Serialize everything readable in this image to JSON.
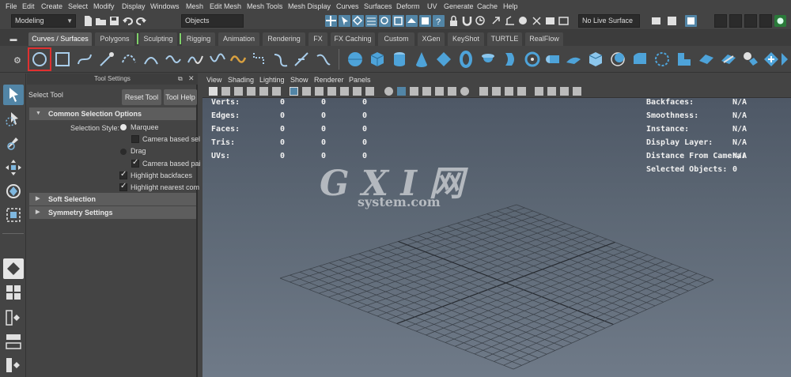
{
  "menubar": {
    "items": [
      "File",
      "Edit",
      "Create",
      "Select",
      "Modify",
      "Display",
      "Windows",
      "Mesh",
      "Edit Mesh",
      "Mesh Tools",
      "Mesh Display",
      "Curves",
      "Surfaces",
      "Deform",
      "UV",
      "Generate",
      "Cache",
      "Help"
    ]
  },
  "statusline": {
    "menuset": "Modeling",
    "selection_mode": "Objects",
    "live_surface": "No Live Surface"
  },
  "shelf": {
    "tabs": [
      "Curves / Surfaces",
      "Polygons",
      "Sculpting",
      "Rigging",
      "Animation",
      "Rendering",
      "FX",
      "FX Caching",
      "Custom",
      "XGen",
      "KeyShot",
      "TURTLE",
      "RealFlow"
    ],
    "active_tab": "Curves / Surfaces"
  },
  "tool_settings": {
    "panel_title": "Tool Settings",
    "tool_name": "Select Tool",
    "reset_button": "Reset Tool",
    "help_button": "Tool Help",
    "sections": {
      "common": "Common Selection Options",
      "soft": "Soft Selection",
      "symmetry": "Symmetry Settings"
    },
    "selection_style_label": "Selection Style:",
    "marquee": "Marquee",
    "camera_based_sel": "Camera based sel",
    "drag": "Drag",
    "camera_based_pai": "Camera based pai",
    "highlight_backfaces": "Highlight backfaces",
    "highlight_nearest": "Highlight nearest com"
  },
  "viewport": {
    "menu": [
      "View",
      "Shading",
      "Lighting",
      "Show",
      "Renderer",
      "Panels"
    ],
    "hud_left": [
      {
        "label": "Verts:",
        "a": "0",
        "b": "0",
        "c": "0"
      },
      {
        "label": "Edges:",
        "a": "0",
        "b": "0",
        "c": "0"
      },
      {
        "label": "Faces:",
        "a": "0",
        "b": "0",
        "c": "0"
      },
      {
        "label": "Tris:",
        "a": "0",
        "b": "0",
        "c": "0"
      },
      {
        "label": "UVs:",
        "a": "0",
        "b": "0",
        "c": "0"
      }
    ],
    "hud_right": [
      {
        "label": "Backfaces:",
        "value": "N/A"
      },
      {
        "label": "Smoothness:",
        "value": "N/A"
      },
      {
        "label": "Instance:",
        "value": "N/A"
      },
      {
        "label": "Display Layer:",
        "value": "N/A"
      },
      {
        "label": "Distance From Camera:",
        "value": "N/A"
      },
      {
        "label": "Selected Objects:",
        "value": "0"
      }
    ],
    "watermark_main": "G X I 网",
    "watermark_sub": "system.com"
  },
  "colors": {
    "accent_blue": "#5285a6",
    "highlight_red": "#e03030",
    "panel_bg": "#444444"
  }
}
